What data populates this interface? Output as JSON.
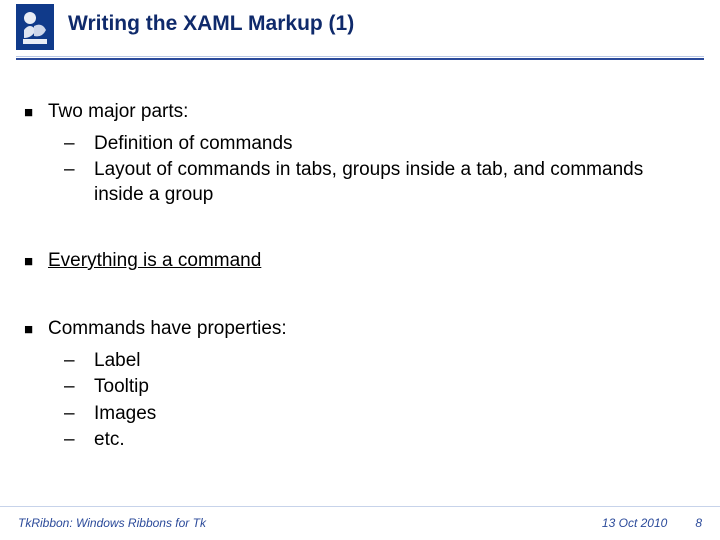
{
  "header": {
    "title": "Writing the XAML Markup (1)",
    "logo_name": "demokritos-logo"
  },
  "content": {
    "b1": {
      "text": "Two major parts:"
    },
    "b1_subs": [
      "Definition of commands",
      "Layout of commands in tabs, groups inside a tab, and commands inside a group"
    ],
    "b2": {
      "text": "Everything is a command"
    },
    "b3": {
      "text": "Commands have properties:"
    },
    "b3_subs": [
      "Label",
      "Tooltip",
      "Images",
      "etc."
    ]
  },
  "footer": {
    "left": "TkRibbon: Windows Ribbons for Tk",
    "date": "13 Oct 2010",
    "page": "8"
  },
  "colors": {
    "brand_dark": "#0f2a6b",
    "brand_mid": "#2b4a9a",
    "logo_bg": "#103a8a"
  }
}
